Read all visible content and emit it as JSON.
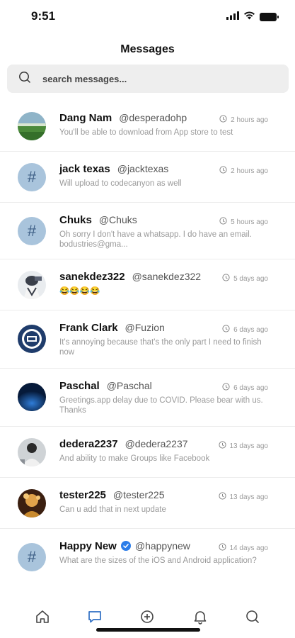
{
  "status": {
    "time": "9:51"
  },
  "header": {
    "title": "Messages"
  },
  "search": {
    "placeholder": "search messages..."
  },
  "messages": [
    {
      "name": "Dang Nam",
      "handle": "@desperadohp",
      "time": "2 hours ago",
      "preview": "You'll be able to download from App store to test",
      "avatar": "photo-green-field",
      "verified": false
    },
    {
      "name": "jack texas",
      "handle": "@jacktexas",
      "time": "2 hours ago",
      "preview": "Will upload to codecanyon as well",
      "avatar": "hash",
      "verified": false
    },
    {
      "name": "Chuks",
      "handle": "@Chuks",
      "time": "5 hours ago",
      "preview": "Oh sorry I don't have a whatsapp. I do have an email. bodustries@gma...",
      "avatar": "hash",
      "verified": false
    },
    {
      "name": "sanekdez322",
      "handle": "@sanekdez322",
      "time": "5 days ago",
      "preview": "😂😂😂😂",
      "avatar": "photo-white",
      "verified": false
    },
    {
      "name": "Frank Clark",
      "handle": "@Fuzion",
      "time": "6 days ago",
      "preview": "It's annoying because that's the only part I need to finish now",
      "avatar": "photo-badge",
      "verified": false
    },
    {
      "name": "Paschal",
      "handle": "@Paschal",
      "time": "6 days ago",
      "preview": "Greetings.app delay due to COVID. Please bear with us. Thanks",
      "avatar": "photo-blue-planet",
      "verified": false
    },
    {
      "name": "dedera2237",
      "handle": "@dedera2237",
      "time": "13 days ago",
      "preview": "And ability to make Groups like Facebook",
      "avatar": "photo-person",
      "verified": false
    },
    {
      "name": "tester225",
      "handle": "@tester225",
      "time": "13 days ago",
      "preview": "Can u add that in next update",
      "avatar": "photo-gold",
      "verified": false
    },
    {
      "name": "Happy New",
      "handle": "@happynew",
      "time": "14 days ago",
      "preview": "What are the sizes of the iOS and Android application?",
      "avatar": "hash",
      "verified": true
    }
  ],
  "nav": [
    {
      "icon": "home-icon",
      "active": false
    },
    {
      "icon": "messages-icon",
      "active": true
    },
    {
      "icon": "add-icon",
      "active": false
    },
    {
      "icon": "notifications-icon",
      "active": false
    },
    {
      "icon": "search-icon",
      "active": false
    }
  ],
  "colors": {
    "accent": "#2f6fc4",
    "avatar_hash_bg": "#a9c4dc",
    "muted": "#9a9a9a",
    "verified": "#2b7de9"
  }
}
